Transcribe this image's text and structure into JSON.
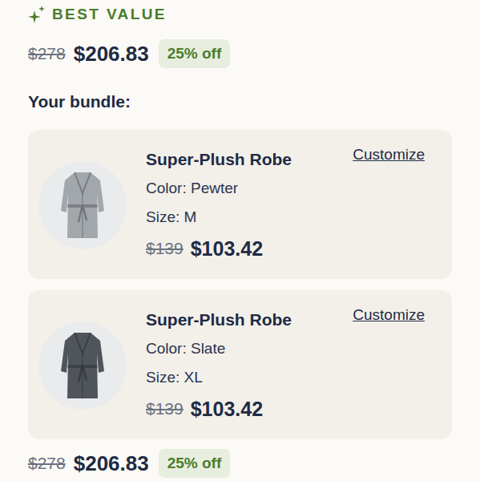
{
  "header": {
    "label": "BEST VALUE"
  },
  "price": {
    "original": "$278",
    "current": "$206.83",
    "discount": "25% off"
  },
  "bundle_title": "Your bundle:",
  "items": [
    {
      "name": "Super-Plush Robe",
      "color_label": "Color: Pewter",
      "size": "Size: M",
      "original": "$139",
      "price": "$103.42",
      "action": "Customize",
      "color": "#a2a7ac"
    },
    {
      "name": "Super-Plush Robe",
      "color_label": "Color: Slate",
      "size": "Size: XL",
      "original": "$139",
      "price": "$103.42",
      "action": "Customize",
      "color": "#4f555b"
    }
  ],
  "footer_price": {
    "original": "$278",
    "current": "$206.83",
    "discount": "25% off"
  }
}
